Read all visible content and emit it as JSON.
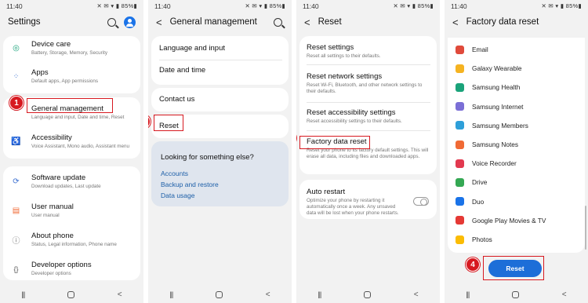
{
  "status": {
    "time": "11:40",
    "icons": "✕ ✉ ▾ ▮ 85%▮"
  },
  "screen1": {
    "title": "Settings",
    "items": [
      {
        "title": "Device care",
        "sub": "Battery, Storage, Memory, Security"
      },
      {
        "title": "Apps",
        "sub": "Default apps, App permissions"
      },
      {
        "title": "General management",
        "sub": "Language and input, Date and time, Reset"
      },
      {
        "title": "Accessibility",
        "sub": "Voice Assistant, Mono audio, Assistant menu"
      },
      {
        "title": "Software update",
        "sub": "Download updates, Last update"
      },
      {
        "title": "User manual",
        "sub": "User manual"
      },
      {
        "title": "About phone",
        "sub": "Status, Legal information, Phone name"
      },
      {
        "title": "Developer options",
        "sub": "Developer options"
      }
    ]
  },
  "screen2": {
    "title": "General management",
    "items": [
      "Language and input",
      "Date and time",
      "Contact us",
      "Reset"
    ],
    "suggest_title": "Looking for something else?",
    "links": [
      "Accounts",
      "Backup and restore",
      "Data usage"
    ]
  },
  "screen3": {
    "title": "Reset",
    "items": [
      {
        "title": "Reset settings",
        "sub": "Reset all settings to their defaults."
      },
      {
        "title": "Reset network settings",
        "sub": "Reset Wi-Fi, Bluetooth, and other network settings to their defaults."
      },
      {
        "title": "Reset accessibility settings",
        "sub": "Reset accessibility settings to their defaults."
      },
      {
        "title": "Factory data reset",
        "sub": "Reset your phone to its factory default settings. This will erase all data, including files and downloaded apps."
      }
    ],
    "auto_restart": {
      "title": "Auto restart",
      "sub": "Optimize your phone by restarting it automatically once a week. Any unsaved data will be lost when your phone restarts."
    }
  },
  "screen4": {
    "title": "Factory data reset",
    "apps": [
      {
        "name": "Email",
        "color": "#e04a3b"
      },
      {
        "name": "Galaxy Wearable",
        "color": "#f5b321"
      },
      {
        "name": "Samsung Health",
        "color": "#1aa37a"
      },
      {
        "name": "Samsung Internet",
        "color": "#7b6fd6"
      },
      {
        "name": "Samsung Members",
        "color": "#2e9fd9"
      },
      {
        "name": "Samsung Notes",
        "color": "#f06a35"
      },
      {
        "name": "Voice Recorder",
        "color": "#e2394f"
      },
      {
        "name": "Drive",
        "color": "#34a853"
      },
      {
        "name": "Duo",
        "color": "#1a73e8"
      },
      {
        "name": "Google Play Movies & TV",
        "color": "#e53935"
      },
      {
        "name": "Photos",
        "color": "#fbbc04"
      }
    ],
    "reset_label": "Reset"
  },
  "callouts": [
    "1",
    "2",
    "3",
    "4"
  ],
  "nav": {
    "recent": "|||",
    "back": "<"
  }
}
